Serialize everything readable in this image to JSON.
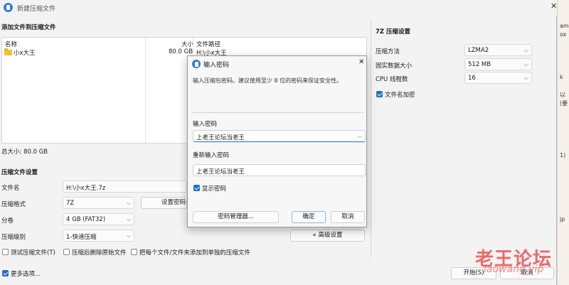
{
  "window": {
    "title": "新建压缩文件",
    "close": "✕"
  },
  "add_files": {
    "heading": "添加文件到压缩文件",
    "columns": {
      "name": "名称",
      "size": "大小",
      "path": "文件路径"
    },
    "rows": [
      {
        "name": "小x大王",
        "size": "80.0 GB",
        "path": "H:\\小x大王"
      }
    ],
    "total": "总大小: 80.0 GB"
  },
  "settings": {
    "heading": "压缩文件设置",
    "filename_label": "文件名",
    "filename_value": "H:\\小x大王.7z",
    "format_label": "压缩格式",
    "format_value": "7Z",
    "set_password_button": "设置密码(",
    "split_label": "分卷",
    "split_value": "4 GB (FAT32)",
    "level_label": "压缩级别",
    "level_value": "1-快速压缩",
    "advanced_button": "« 高级设置",
    "test_label": "测试压缩文件(T)",
    "delete_label": "压缩后删除原始文件",
    "each_label": "把每个文件/文件夹添加到单独的压缩文件"
  },
  "footer": {
    "more_options": "更多选项...",
    "start_button": "开始(S)",
    "cancel_button": "取消"
  },
  "sevenzip": {
    "heading": "7Z 压缩设置",
    "method_label": "压缩方法",
    "method_value": "LZMA2",
    "dict_label": "固实数据大小",
    "dict_value": "512 MB",
    "threads_label": "CPU 线程数",
    "threads_value": "16",
    "encrypt_names_label": "文件名加密"
  },
  "dialog": {
    "title": "输入密码",
    "close": "✕",
    "hint": "输入压缩包密码。建议使用至少 8 位的密码来保证安全性。",
    "enter_label": "输入密码",
    "enter_value": "上老王论坛当老王",
    "reenter_label": "重新输入密码",
    "reenter_value": "上老王论坛当老王",
    "show_label": "显示密码",
    "manager_button": "密码管理器...",
    "ok_button": "确定",
    "cancel_button": "取消"
  },
  "watermark": {
    "main": "老王论坛",
    "url": "laowang.vip"
  },
  "background_snippets": [
    "am",
    "ox",
    "k",
    "以",
    "(要",
    "1)",
    "jp"
  ],
  "colors": {
    "accent": "#1e6fc5",
    "watermark": "#ec4b4b"
  }
}
